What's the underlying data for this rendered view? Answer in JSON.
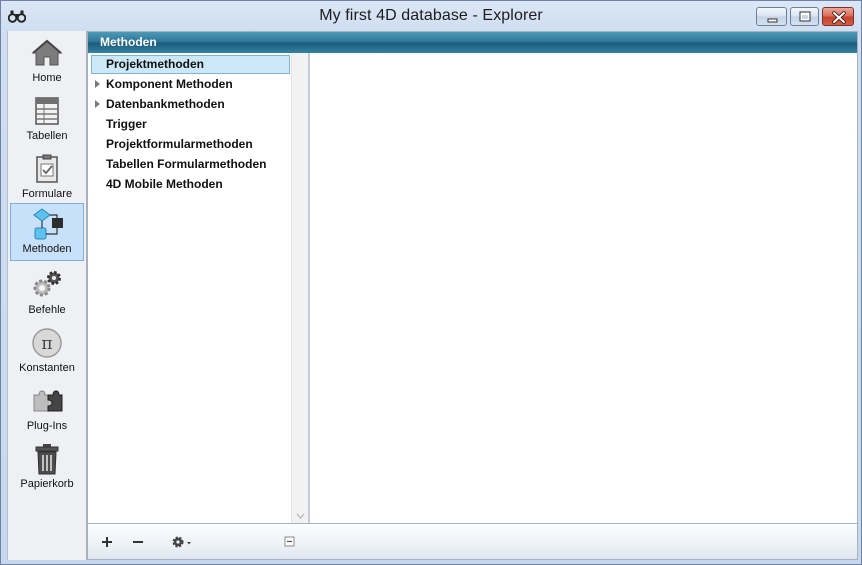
{
  "window": {
    "title": "My first 4D database - Explorer"
  },
  "sidebar": {
    "items": [
      {
        "label": "Home",
        "icon": "home-icon"
      },
      {
        "label": "Tabellen",
        "icon": "tables-icon"
      },
      {
        "label": "Formulare",
        "icon": "forms-icon"
      },
      {
        "label": "Methoden",
        "icon": "methods-icon",
        "selected": true
      },
      {
        "label": "Befehle",
        "icon": "commands-icon"
      },
      {
        "label": "Konstanten",
        "icon": "constants-icon"
      },
      {
        "label": "Plug-Ins",
        "icon": "plugins-icon"
      },
      {
        "label": "Papierkorb",
        "icon": "trash-icon"
      }
    ]
  },
  "section": {
    "title": "Methoden"
  },
  "methods": {
    "items": [
      {
        "label": "Projektmethoden",
        "selected": true,
        "expandable": false
      },
      {
        "label": "Komponent Methoden",
        "expandable": true
      },
      {
        "label": "Datenbankmethoden",
        "expandable": true
      },
      {
        "label": "Trigger",
        "expandable": false
      },
      {
        "label": "Projektformularmethoden",
        "expandable": false
      },
      {
        "label": "Tabellen Formularmethoden",
        "expandable": false
      },
      {
        "label": "4D Mobile Methoden",
        "expandable": false
      }
    ]
  },
  "toolbar": {
    "add_icon": "plus-icon",
    "remove_icon": "minus-icon",
    "options_icon": "gear-menu-icon",
    "collapse_icon": "collapse-icon"
  },
  "colors": {
    "header": "#2e7697",
    "selection": "#cce8f7",
    "sidebar_selection": "#c8e1fa"
  }
}
